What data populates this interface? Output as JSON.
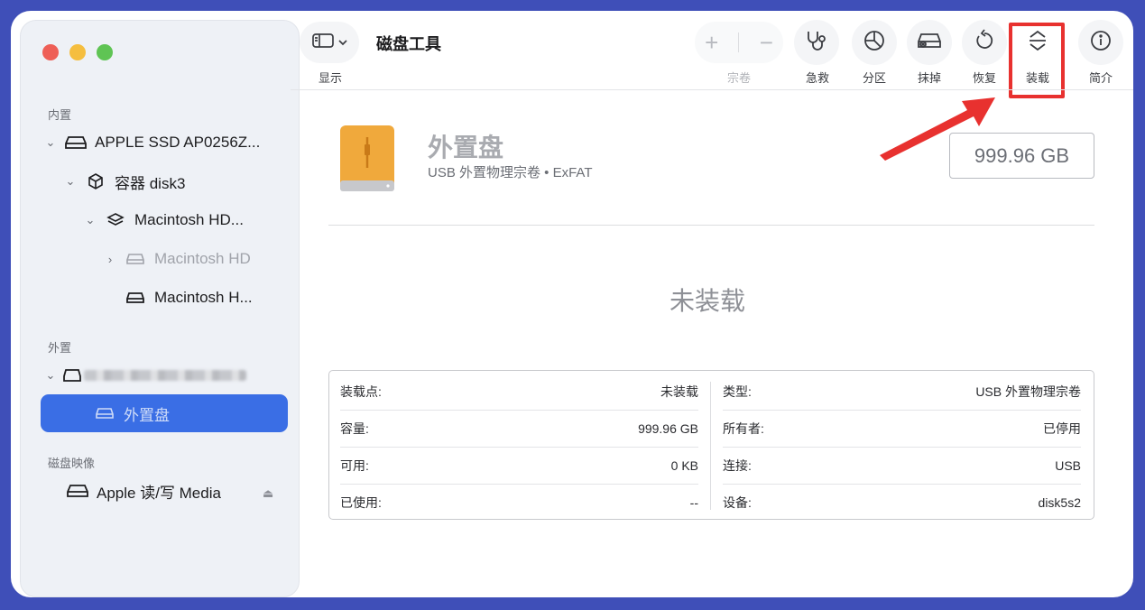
{
  "window": {
    "title": "磁盘工具",
    "view_label": "显示"
  },
  "toolbar": {
    "volume_label": "宗卷",
    "volume_add": "+",
    "volume_remove": "−",
    "first_aid": "急救",
    "partition": "分区",
    "erase": "抹掉",
    "restore": "恢复",
    "mount": "装载",
    "info": "简介"
  },
  "sidebar": {
    "internal_label": "内置",
    "external_label": "外置",
    "images_label": "磁盘映像",
    "internal": [
      {
        "label": "APPLE SSD AP0256Z...",
        "icon": "hard-drive-icon"
      },
      {
        "label": "容器 disk3",
        "icon": "container-icon"
      },
      {
        "label": "Macintosh HD...",
        "icon": "layers-icon"
      },
      {
        "label": "Macintosh HD",
        "icon": "volume-icon"
      },
      {
        "label": "Macintosh H...",
        "icon": "volume-icon"
      }
    ],
    "external": [
      {
        "label": "外置盘",
        "icon": "volume-icon"
      }
    ],
    "images": [
      {
        "label": "Apple 读/写 Media",
        "icon": "hard-drive-icon"
      }
    ]
  },
  "drive": {
    "name": "外置盘",
    "subtitle": "USB 外置物理宗卷 • ExFAT",
    "size": "999.96 GB",
    "status": "未装载"
  },
  "details": {
    "left": [
      {
        "key": "装载点:",
        "value": "未装载"
      },
      {
        "key": "容量:",
        "value": "999.96 GB"
      },
      {
        "key": "可用:",
        "value": "0 KB"
      },
      {
        "key": "已使用:",
        "value": "--"
      }
    ],
    "right": [
      {
        "key": "类型:",
        "value": "USB 外置物理宗卷"
      },
      {
        "key": "所有者:",
        "value": "已停用"
      },
      {
        "key": "连接:",
        "value": "USB"
      },
      {
        "key": "设备:",
        "value": "disk5s2"
      }
    ]
  },
  "colors": {
    "accent": "#3a6ee5",
    "highlight": "#e8312f",
    "drive_orange": "#f0a93c"
  }
}
